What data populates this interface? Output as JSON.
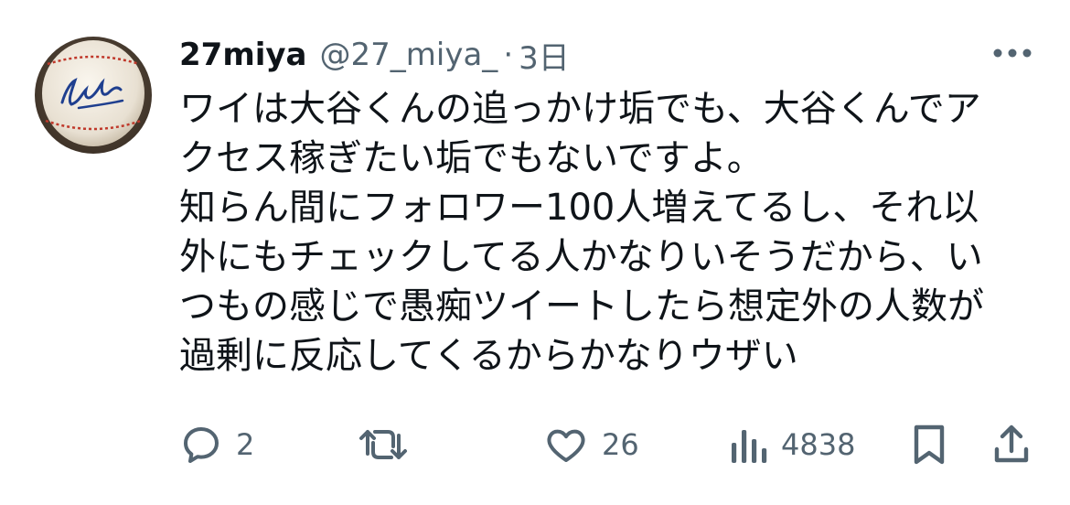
{
  "tweet": {
    "author": {
      "display_name": "27miya",
      "handle": "@27_miya_",
      "separator": "·",
      "time": "3日"
    },
    "text_lines": [
      "ワイは大谷くんの追っかけ垢でも、大谷くんでア",
      "クセス稼ぎたい垢でもないですよ。",
      "知らん間にフォロワー100人増えてるし、それ以",
      "外にもチェックしてる人かなりいそうだから、い",
      "つもの感じで愚痴ツイートしたら想定外の人数が",
      "過剰に反応してくるからかなりウザい"
    ],
    "actions": {
      "reply_count": "2",
      "like_count": "26",
      "view_count": "4838"
    },
    "icons": {
      "avatar": "signed-baseball-avatar",
      "more": "more-horizontal-icon",
      "reply": "reply-icon",
      "retweet": "retweet-icon",
      "like": "heart-icon",
      "views": "views-bar-chart-icon",
      "bookmark": "bookmark-icon",
      "share": "share-icon"
    },
    "colors": {
      "text_primary": "#0f1419",
      "text_secondary": "#536471",
      "background": "#ffffff"
    }
  }
}
